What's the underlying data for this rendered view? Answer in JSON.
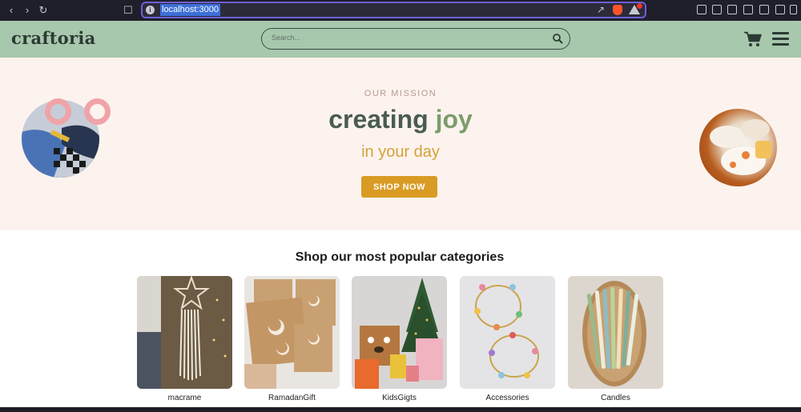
{
  "browser": {
    "url": "localhost:3000"
  },
  "header": {
    "logo": "craftoria",
    "search_placeholder": "Search..."
  },
  "hero": {
    "eyebrow": "OUR MISSION",
    "headline_main": "creating ",
    "headline_accent": "joy",
    "subline": "in your day",
    "cta_label": "SHOP NOW"
  },
  "categories": {
    "title": "Shop our most popular categories",
    "items": [
      {
        "label": "macrame"
      },
      {
        "label": "RamadanGift"
      },
      {
        "label": "KidsGigts"
      },
      {
        "label": "Accessories"
      },
      {
        "label": "Candles"
      }
    ]
  },
  "colors": {
    "header_bg": "#a8c8ad",
    "hero_bg": "#fdf3ee",
    "accent_gold": "#d99b24",
    "headline_green": "#4a5c52"
  }
}
